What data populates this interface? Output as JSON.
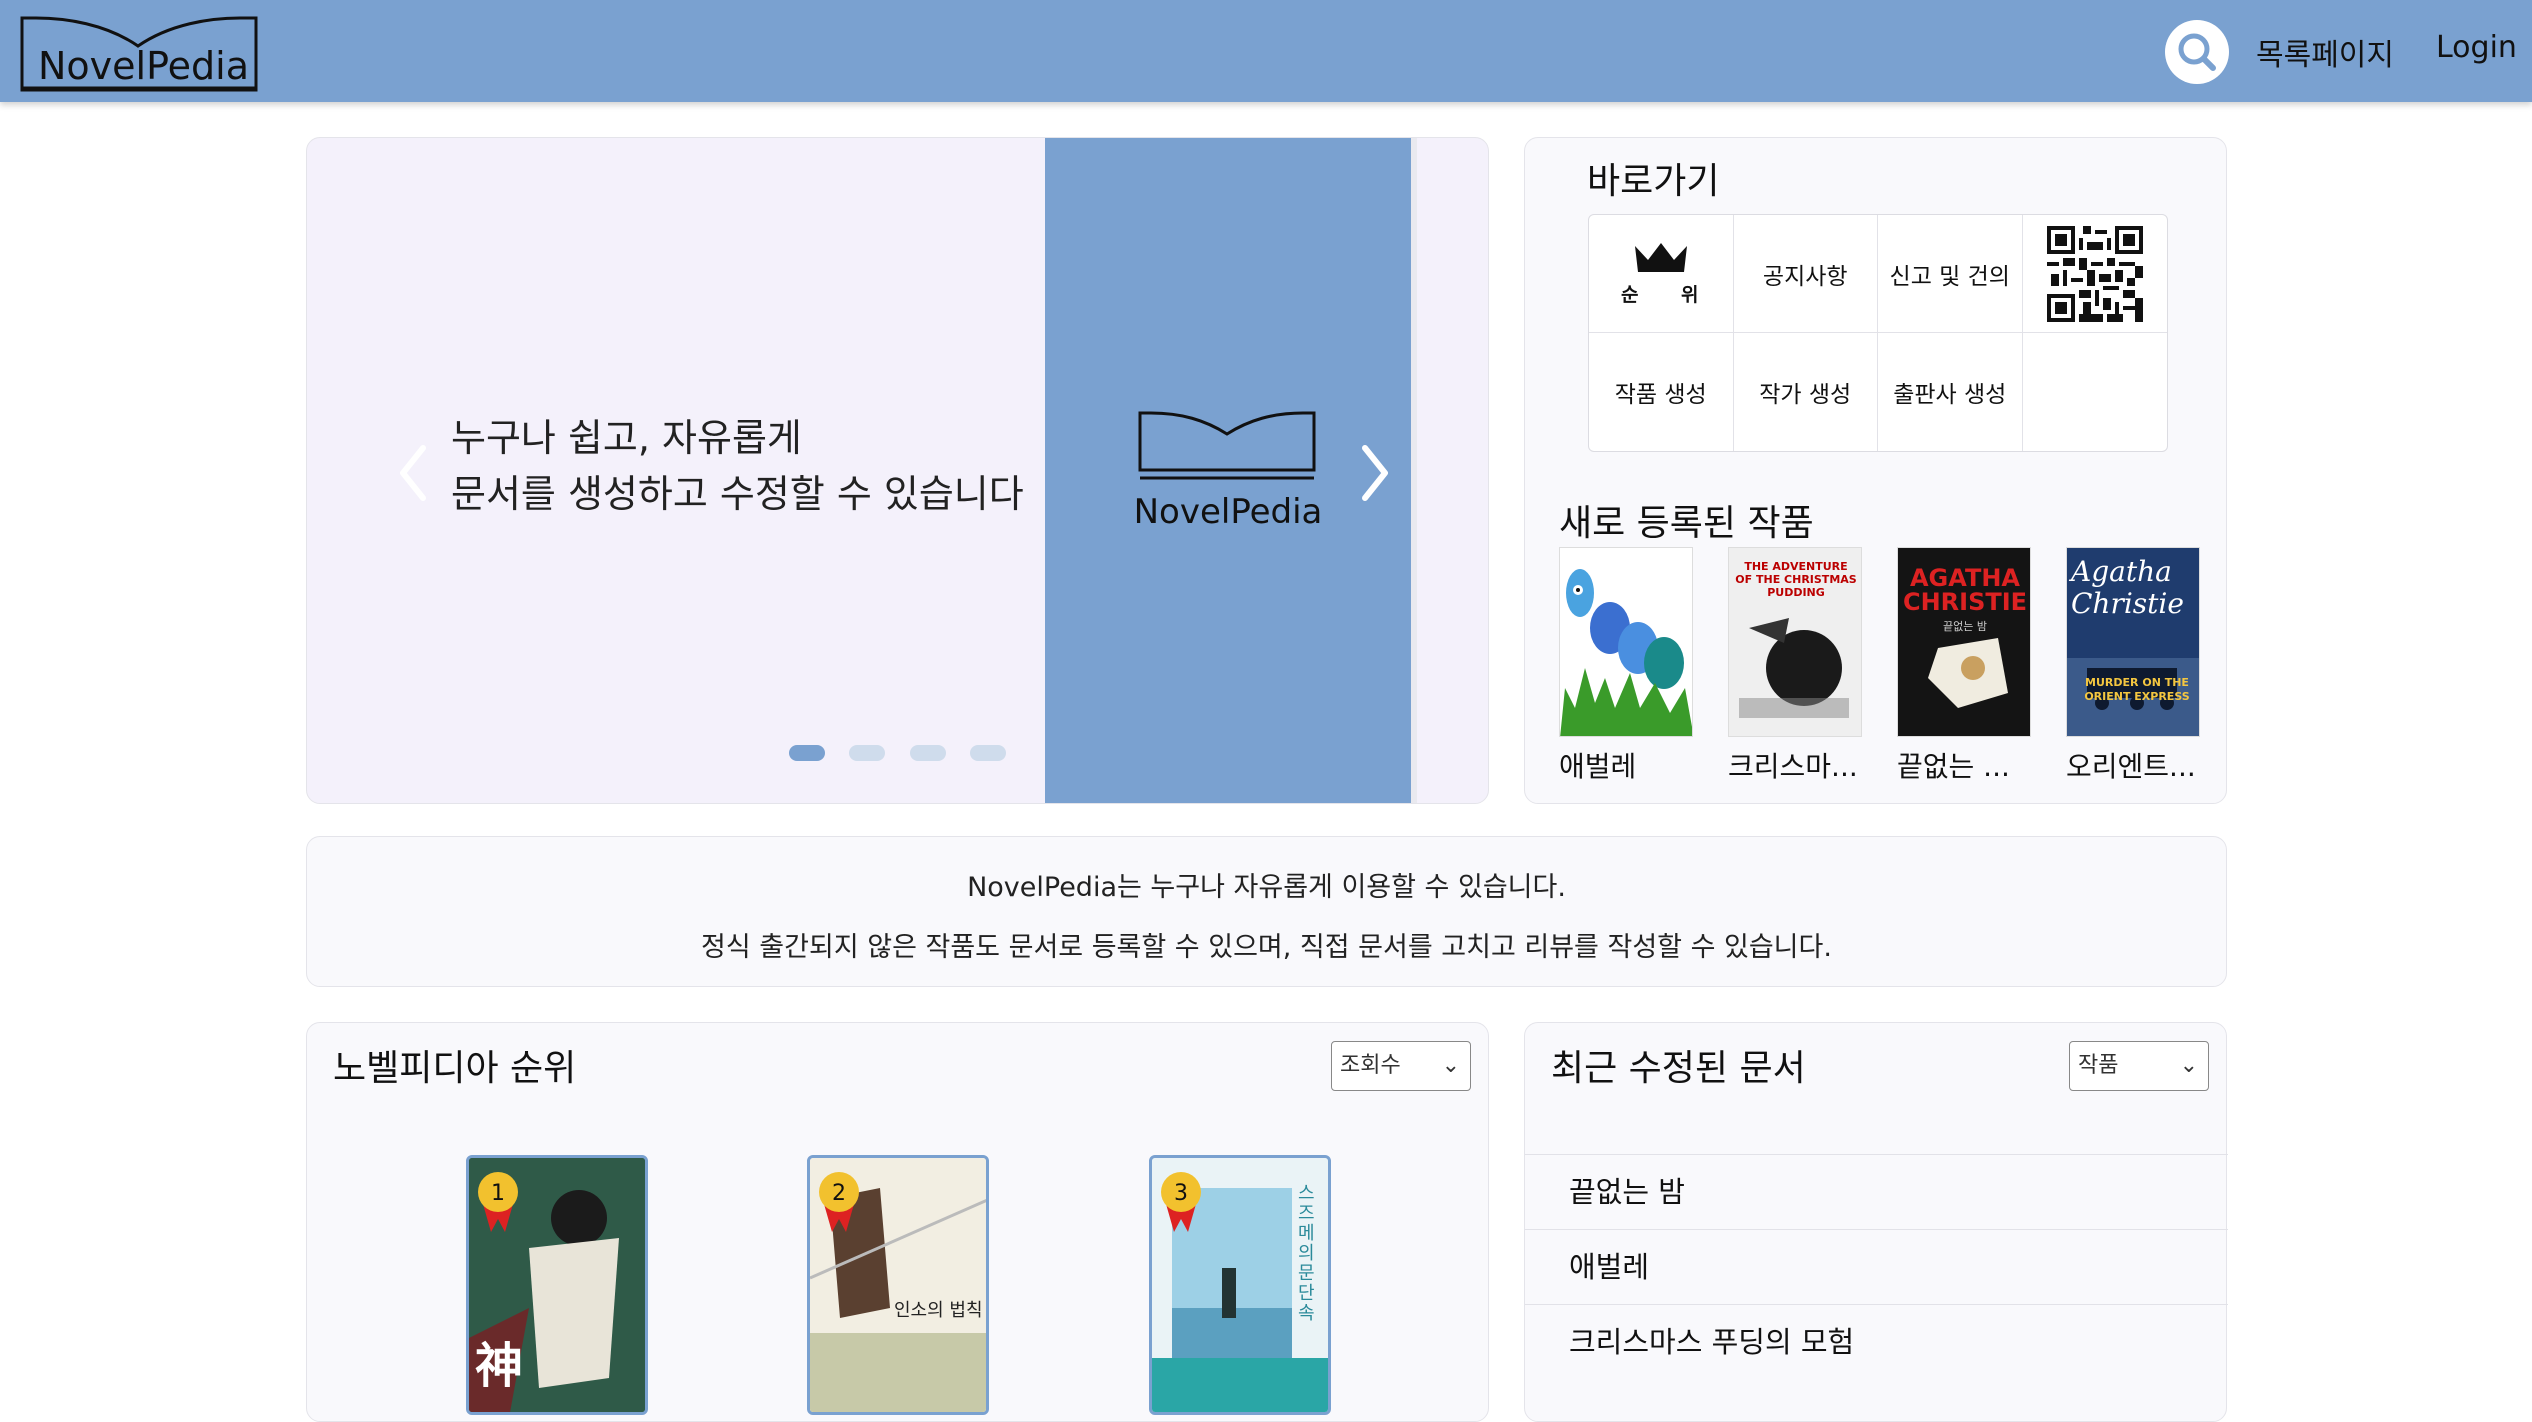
{
  "header": {
    "logo_text": "NovelPedia",
    "nav_list": "목록페이지",
    "nav_login": "Login",
    "search_icon": "search-icon"
  },
  "carousel": {
    "line1": "누구나 쉽고, 자유롭게",
    "line2": "문서를 생성하고 수정할 수 있습니다",
    "logo_text": "NovelPedia",
    "slides_count": 4,
    "active_slide": 1
  },
  "shortcuts": {
    "title": "바로가기",
    "items": [
      {
        "label": "순 위",
        "icon": "crown-icon"
      },
      {
        "label": "공지사항"
      },
      {
        "label": "신고 및 건의"
      },
      {
        "label": "",
        "icon": "qr-code-icon"
      },
      {
        "label": "작품 생성"
      },
      {
        "label": "작가 생성"
      },
      {
        "label": "출판사 생성"
      },
      {
        "label": ""
      }
    ]
  },
  "new_works": {
    "title": "새로 등록된 작품",
    "books": [
      {
        "title": "애벌레"
      },
      {
        "title": "크리스마..."
      },
      {
        "title": "끝없는 ..."
      },
      {
        "title": "오리엔트..."
      }
    ],
    "cover_texts": {
      "christmas": "THE ADVENTURE OF THE CHRISTMAS PUDDING",
      "agatha": "AGATHA CHRISTIE",
      "agatha_sub": "끝없는 밤",
      "orient_script": "Agatha Christie",
      "orient_title": "MURDER ON THE ORIENT EXPRESS"
    }
  },
  "info": {
    "line1": "NovelPedia는 누구나 자유롭게 이용할 수 있습니다.",
    "line2": "정식 출간되지 않은 작품도 문서로 등록할 수 있으며, 직접 문서를 고치고 리뷰를 작성할 수 있습니다."
  },
  "ranking": {
    "title": "노벨피디아 순위",
    "sort_selected": "조회수",
    "books": [
      {
        "rank": "1",
        "cover_text": "神"
      },
      {
        "rank": "2",
        "cover_text": "인소의 법칙"
      },
      {
        "rank": "3",
        "cover_text": "스즈메의 문단속"
      }
    ]
  },
  "recent": {
    "title": "최근 수정된 문서",
    "filter_selected": "작품",
    "items": [
      "끝없는 밤",
      "애벌레",
      "크리스마스 푸딩의 모험"
    ]
  },
  "colors": {
    "header": "#7aa1d0",
    "card_bg": "#f9f9fc",
    "carousel_bg": "#f4f1fb"
  }
}
